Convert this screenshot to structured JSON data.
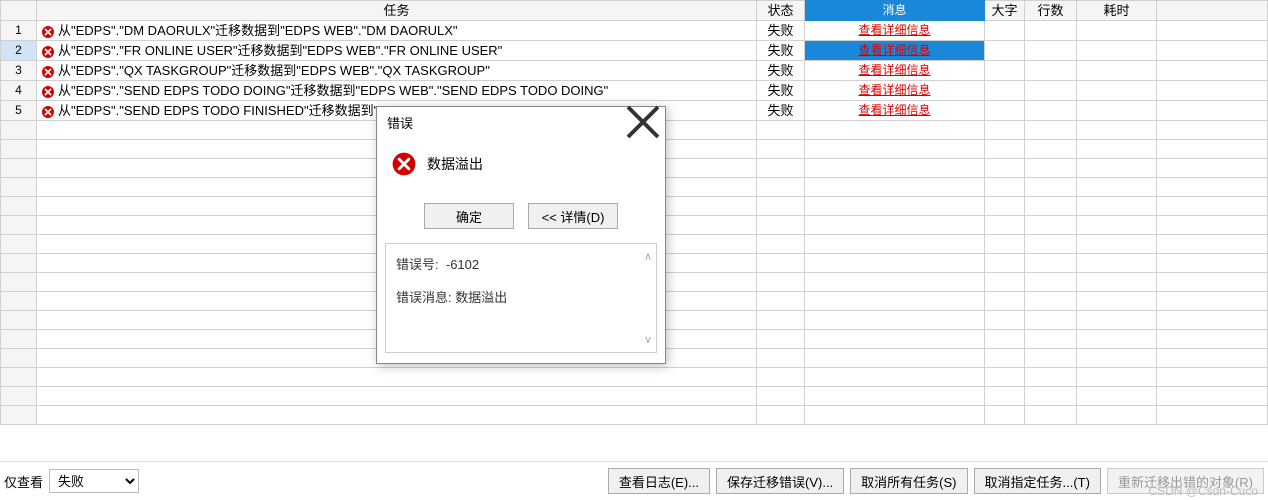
{
  "columns": {
    "task": "任务",
    "status": "状态",
    "message": "消息",
    "font": "大字",
    "rows": "行数",
    "time": "耗时"
  },
  "rows": [
    {
      "n": "1",
      "task": "从\"EDPS\".\"DM DAORULX\"迁移数据到\"EDPS WEB\".\"DM DAORULX\"",
      "status": "失败",
      "msg": "查看详细信息",
      "selected": false
    },
    {
      "n": "2",
      "task": "从\"EDPS\".\"FR ONLINE USER\"迁移数据到\"EDPS WEB\".\"FR ONLINE USER\"",
      "status": "失败",
      "msg": "查看详细信息",
      "selected": true
    },
    {
      "n": "3",
      "task": "从\"EDPS\".\"QX TASKGROUP\"迁移数据到\"EDPS WEB\".\"QX TASKGROUP\"",
      "status": "失败",
      "msg": "查看详细信息",
      "selected": false
    },
    {
      "n": "4",
      "task": "从\"EDPS\".\"SEND EDPS TODO DOING\"迁移数据到\"EDPS WEB\".\"SEND EDPS TODO DOING\"",
      "status": "失败",
      "msg": "查看详细信息",
      "selected": false
    },
    {
      "n": "5",
      "task": "从\"EDPS\".\"SEND EDPS TODO FINISHED\"迁移数据到\"EDPS WEB\".\"SEND EDPS TODO FINISHED\"",
      "status": "失败",
      "msg": "查看详细信息",
      "selected": false
    }
  ],
  "emptyRowsCount": 16,
  "footer": {
    "only_view": "仅查看",
    "filter_value": "失败",
    "view_log": "查看日志(E)...",
    "save_errors": "保存迁移错误(V)...",
    "cancel_all": "取消所有任务(S)",
    "cancel_specific": "取消指定任务...(T)",
    "retry_failed": "重新迁移出错的对象(R)"
  },
  "dialog": {
    "title": "错误",
    "message": "数据溢出",
    "ok": "确定",
    "details": "<< 详情(D)",
    "error_no_label": "错误号:",
    "error_no": "-6102",
    "error_msg_label": "错误消息:",
    "error_msg": "数据溢出"
  },
  "watermark": "CSDN @Csdn-Cuco"
}
